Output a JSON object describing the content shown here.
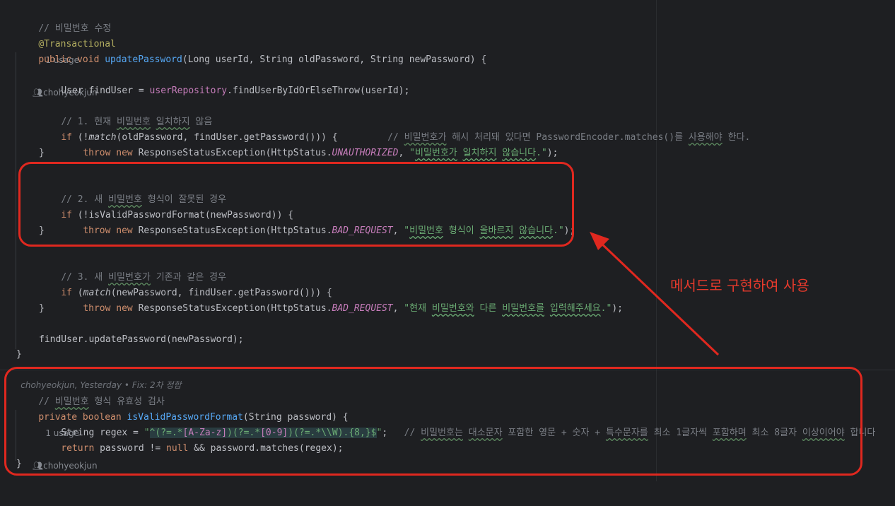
{
  "code": {
    "comment_update": "// 비밀번호 수정",
    "annotation": "@Transactional",
    "usage1": "1 usage",
    "author1": "chohyeokjun",
    "sig": {
      "kw": "public void ",
      "name": "updatePassword",
      "params": "(Long userId, String oldPassword, String newPassword) {"
    },
    "finduser": {
      "pre": "User findUser = ",
      "repo": "userRepository",
      "rest": ".findUserByIdOrElseThrow(userId);"
    },
    "c1": {
      "pre": "// 1. 현재 ",
      "w1": "비밀번호",
      "sp": " ",
      "w2": "일치하지",
      "post": " 않음"
    },
    "if1": {
      "kw": "if",
      "a": " (!",
      "match": "match",
      "b": "(oldPassword, findUser.getPassword())) {",
      "gap": "         ",
      "cm_pre": "// ",
      "cm_w1": "비밀번호가",
      "cm_mid": " 해시 처리돼 있다면 PasswordEncoder.matches()를 ",
      "cm_w2": "사용해야",
      "cm_post": " 한다."
    },
    "throw1": {
      "kw": "throw new ",
      "cls": "ResponseStatusException(HttpStatus.",
      "const": "UNAUTHORIZED",
      "mid": ", ",
      "q1": "\"",
      "s1": "비밀번호가",
      "sp": " ",
      "s2": "일치하지",
      "sp2": " ",
      "s3": "않습니다",
      "q2": ".\"",
      "end": ");"
    },
    "close_brace": "}",
    "c2": {
      "pre": "// 2. 새 ",
      "w1": "비밀번호",
      "post": " 형식이 잘못된 경우"
    },
    "if2": {
      "kw": "if",
      "a": " (!",
      "fn": "isValidPasswordFormat",
      "b": "(newPassword)) {"
    },
    "throw2": {
      "kw": "throw new ",
      "cls": "ResponseStatusException(HttpStatus.",
      "const": "BAD_REQUEST",
      "mid": ", ",
      "q1": "\"",
      "s1": "비밀번호",
      "mid2": " 형식이 ",
      "s2": "올바르지",
      "sp": " ",
      "s3": "않습니다",
      "q2": ".\"",
      "end": ");"
    },
    "c3": {
      "pre": "// 3. 새 ",
      "w1": "비밀번호가",
      "post": " 기존과 같은 경우"
    },
    "if3": {
      "kw": "if",
      "a": " (",
      "match": "match",
      "b": "(newPassword, findUser.getPassword())) {"
    },
    "throw3": {
      "kw": "throw new ",
      "cls": "ResponseStatusException(HttpStatus.",
      "const": "BAD_REQUEST",
      "mid": ", ",
      "q1": "\"현재 ",
      "s1": "비밀번호와",
      "mid2": " 다른 ",
      "s2": "비밀번호를",
      "sp": " ",
      "s3": "입력해주세요",
      "q2": ".\"",
      "end": ");"
    },
    "update_call": "findUser.updatePassword(newPassword);",
    "blame": "chohyeokjun, Yesterday • Fix: 2차 정합",
    "comment_valid": {
      "pre": "// ",
      "w1": "비밀번호",
      "post": " 형식 유효성 검사"
    },
    "sig2": {
      "kw": "private boolean ",
      "name": "isValidPasswordFormat",
      "params": "(String password) {"
    },
    "usage2": "1 usage",
    "author2": "chohyeokjun",
    "regex_line": {
      "pre": "String regex = ",
      "q1": "\"",
      "caret": "^",
      "p1": "(?=.*",
      "cls1": "[A-Za-z]",
      "p2": ")(?=.*",
      "cls2": "[0-9]",
      "p3": ")(?=.*\\\\W)",
      "rep": ".{8,}",
      "dollar": "$",
      "q2": "\"",
      "end": ";",
      "gap": "   ",
      "cm_pre": "// ",
      "cm_w1": "비밀번호는",
      "cm_s1": " ",
      "cm_w2": "대소문자",
      "cm_m1": " 포함한 영문 + 숫자 + ",
      "cm_w3": "특수문자를",
      "cm_m2": " 최소 1글자씩 ",
      "cm_w4": "포함하며",
      "cm_m3": " 최소 8글자 ",
      "cm_w5": "이상이어야",
      "cm_post": " 합니다"
    },
    "return_line": {
      "kw": "return ",
      "a": "password != ",
      "null": "null",
      "b": " && password.matches(regex);"
    }
  },
  "callout_text": "메서드로 구현하여 사용",
  "colors": {
    "background": "#1e1f22",
    "keyword": "#cf8e6d",
    "function": "#56a8f5",
    "string": "#6aab73",
    "comment": "#7a7e85",
    "annotation": "#b3ae60",
    "constant": "#c77dbb",
    "callout": "#e0281f"
  }
}
